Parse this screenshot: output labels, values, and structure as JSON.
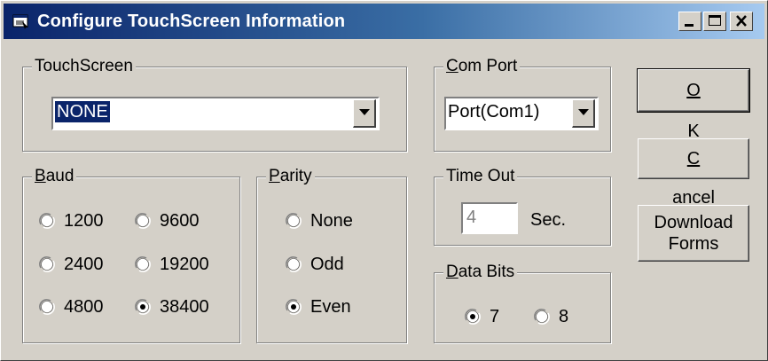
{
  "window": {
    "title": "Configure TouchScreen Information"
  },
  "touchscreen": {
    "legend": "TouchScreen",
    "selected": "NONE"
  },
  "comport": {
    "legend_accel": "C",
    "legend_rest": "om Port",
    "selected": "Port(Com1)"
  },
  "baud": {
    "legend_accel": "B",
    "legend_rest": "aud",
    "options": [
      "1200",
      "9600",
      "2400",
      "19200",
      "4800",
      "38400"
    ],
    "selected": "38400"
  },
  "parity": {
    "legend_accel": "P",
    "legend_rest": "arity",
    "options": [
      "None",
      "Odd",
      "Even"
    ],
    "selected": "Even"
  },
  "timeout": {
    "legend": "Time Out",
    "value": "4",
    "unit": "Sec."
  },
  "databits": {
    "legend_accel": "D",
    "legend_rest": "ata Bits",
    "options": [
      "7",
      "8"
    ],
    "selected": "7"
  },
  "buttons": {
    "ok_accel": "O",
    "ok_rest": "K",
    "cancel_accel": "C",
    "cancel_rest": "ancel",
    "download_line1": "Download",
    "download_line2": "Forms"
  }
}
